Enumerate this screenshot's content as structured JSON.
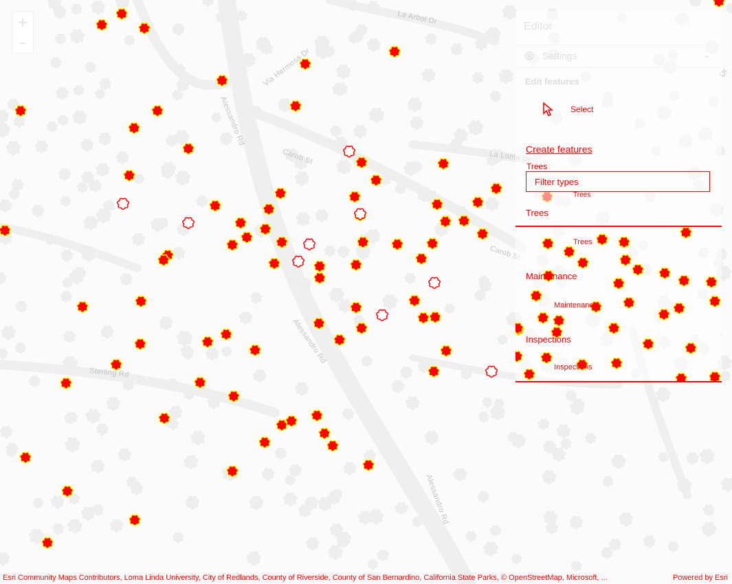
{
  "map": {
    "zoom_in_label": "+",
    "zoom_out_label": "–",
    "road_labels": [
      "La Arbol Dr",
      "Via Hermosa Dr",
      "Alessandro Rd",
      "Carob St",
      "La Loma Dr",
      "Carob St",
      "Alessandro Rd",
      "Sterling Rd",
      "Alessandro Rd",
      "Kincaid St",
      "Dr"
    ],
    "tree_icon": "tree-symbol-icon",
    "tree_fill_color": "#ff0000",
    "tree_outline_color": "#ffff00",
    "attribution": "Esri Community Maps Contributors, Loma Linda University, City of Redlands, County of Riverside, County of San Bernardino, California State Parks, © OpenStreetMap, Microsoft, ...",
    "powered_by": "Powered by Esri"
  },
  "editor": {
    "title": "Editor",
    "settings_label": "Settings",
    "settings_icon": "gear-icon",
    "edit_features_heading": "Edit features",
    "select_label": "Select",
    "select_icon": "cursor-icon",
    "create_features_heading": "Create features",
    "trees_caption": "Trees",
    "filter_placeholder": "Filter types",
    "groups": [
      {
        "name": "Trees",
        "item": "Trees"
      },
      {
        "name": "Maintenance",
        "item": "Maintenance"
      },
      {
        "name": "Inspections",
        "item": "Inspections"
      }
    ],
    "floating_trees_label": "Trees"
  }
}
